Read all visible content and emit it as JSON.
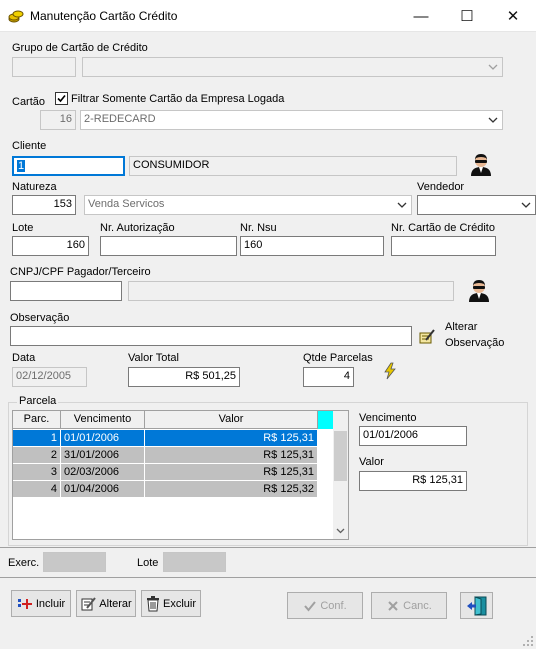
{
  "window": {
    "title": "Manutenção Cartão Crédito",
    "minimize": "—",
    "maximize": "☐",
    "close": "✕"
  },
  "grupo": {
    "label": "Grupo de Cartão de Crédito",
    "code": "",
    "name": ""
  },
  "cartao": {
    "label": "Cartão",
    "filter_label": "Filtrar Somente Cartão da Empresa Logada",
    "filter_checked": true,
    "code": "16",
    "name": "2-REDECARD"
  },
  "cliente": {
    "label": "Cliente",
    "code": "1",
    "name": "CONSUMIDOR"
  },
  "natureza": {
    "label": "Natureza",
    "code": "153",
    "name": "Venda Servicos"
  },
  "vendedor": {
    "label": "Vendedor",
    "value": ""
  },
  "lote": {
    "label": "Lote",
    "value": "160"
  },
  "autorizacao": {
    "label": "Nr. Autorização",
    "value": ""
  },
  "nsu": {
    "label": "Nr. Nsu",
    "value": "160"
  },
  "nr_cartao": {
    "label": "Nr. Cartão de Crédito",
    "value": ""
  },
  "cnpj": {
    "label": "CNPJ/CPF Pagador/Terceiro",
    "value": "",
    "name": ""
  },
  "observacao": {
    "label": "Observação",
    "value": "",
    "alterar_label_1": "Alterar",
    "alterar_label_2": "Observação"
  },
  "data": {
    "label": "Data",
    "value": "02/12/2005"
  },
  "valor_total": {
    "label": "Valor Total",
    "value": "R$ 501,25"
  },
  "qtde_parcelas": {
    "label": "Qtde Parcelas",
    "value": "4"
  },
  "parcela": {
    "group_label": "Parcela",
    "headers": [
      "Parc.",
      "Vencimento",
      "Valor"
    ],
    "rows": [
      {
        "parc": "1",
        "vencimento": "01/01/2006",
        "valor": "R$ 125,31"
      },
      {
        "parc": "2",
        "vencimento": "31/01/2006",
        "valor": "R$ 125,31"
      },
      {
        "parc": "3",
        "vencimento": "02/03/2006",
        "valor": "R$ 125,31"
      },
      {
        "parc": "4",
        "vencimento": "01/04/2006",
        "valor": "R$ 125,32"
      }
    ],
    "selected_row": 0,
    "vencimento_label": "Vencimento",
    "vencimento_value": "01/01/2006",
    "valor_label": "Valor",
    "valor_value": "R$ 125,31"
  },
  "footer": {
    "exerc_label": "Exerc.",
    "exerc_value": "",
    "lote_label": "Lote",
    "lote_value": ""
  },
  "buttons": {
    "incluir": "Incluir",
    "alterar": "Alterar",
    "excluir": "Excluir",
    "conf": "Conf.",
    "canc": "Canc."
  },
  "colors": {
    "selection": "#0078d7",
    "row_gray": "#c0c0c0",
    "scroll_corner": "#00ffff",
    "bolt": "#e8c800"
  }
}
